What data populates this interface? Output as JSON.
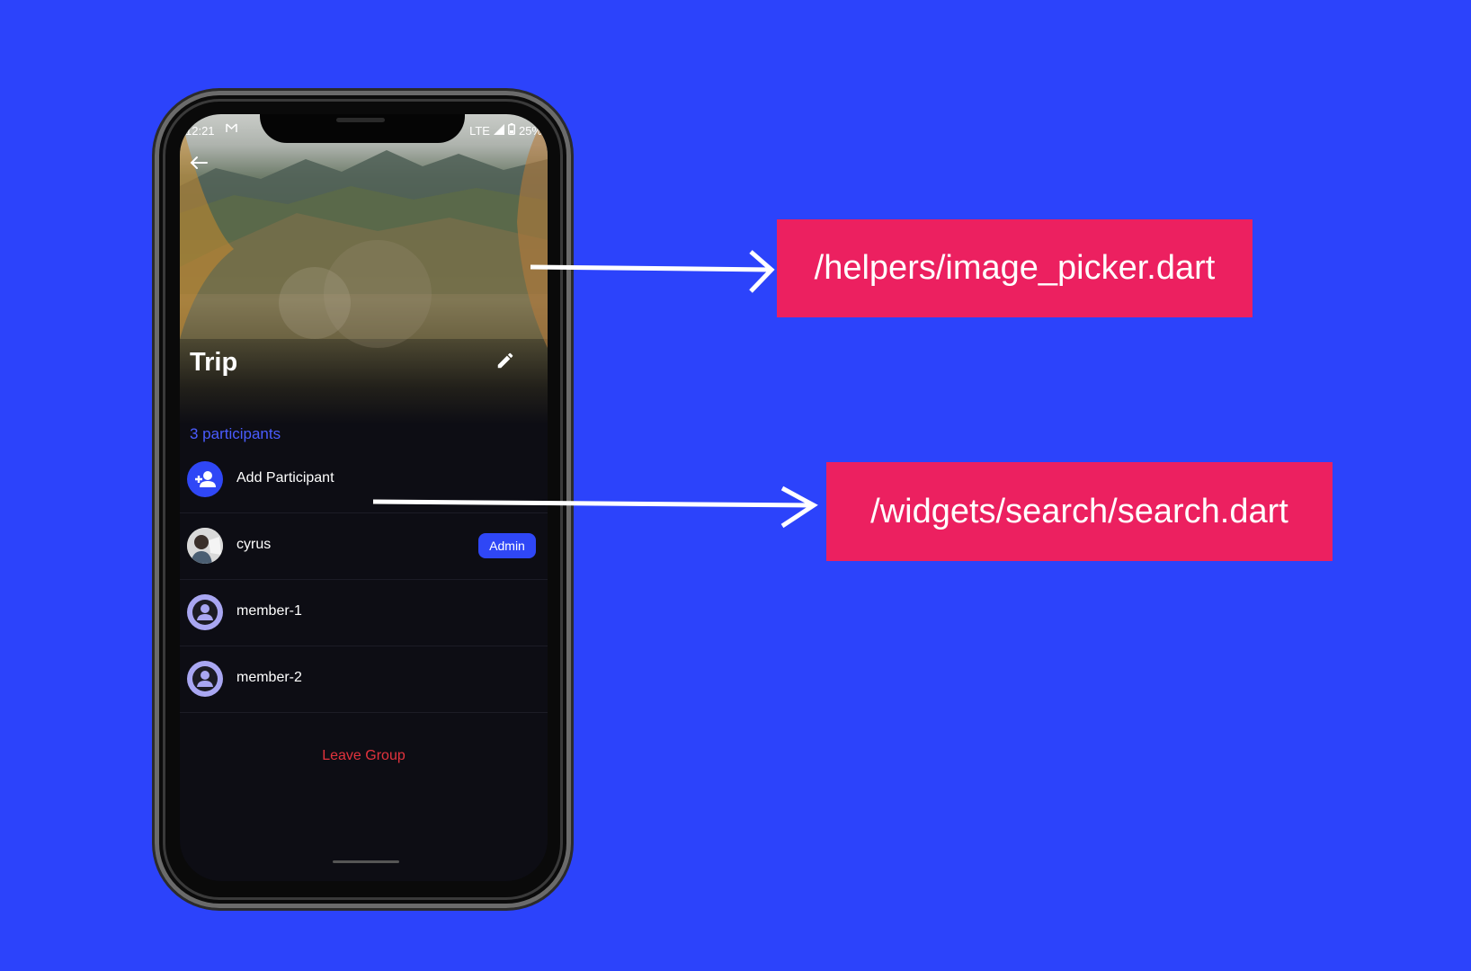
{
  "status_bar": {
    "time": "12:21",
    "network": "LTE",
    "battery": "25%"
  },
  "group": {
    "title": "Trip",
    "participants_count": "3 participants"
  },
  "participants": {
    "add_label": "Add Participant",
    "items": [
      {
        "name": "cyrus",
        "badge": "Admin"
      },
      {
        "name": "member-1"
      },
      {
        "name": "member-2"
      }
    ]
  },
  "leave_label": "Leave Group",
  "callouts": {
    "image_picker": "/helpers/image_picker.dart",
    "search": "/widgets/search/search.dart"
  },
  "colors": {
    "background": "#2c43fb",
    "callout": "#ec2060",
    "accent": "#2f47f6",
    "danger": "#e3333d",
    "screen": "#0d0d14"
  },
  "icons": [
    "back-arrow-icon",
    "edit-pencil-icon",
    "add-person-icon",
    "person-icon",
    "gmail-icon",
    "signal-icon",
    "battery-icon"
  ]
}
